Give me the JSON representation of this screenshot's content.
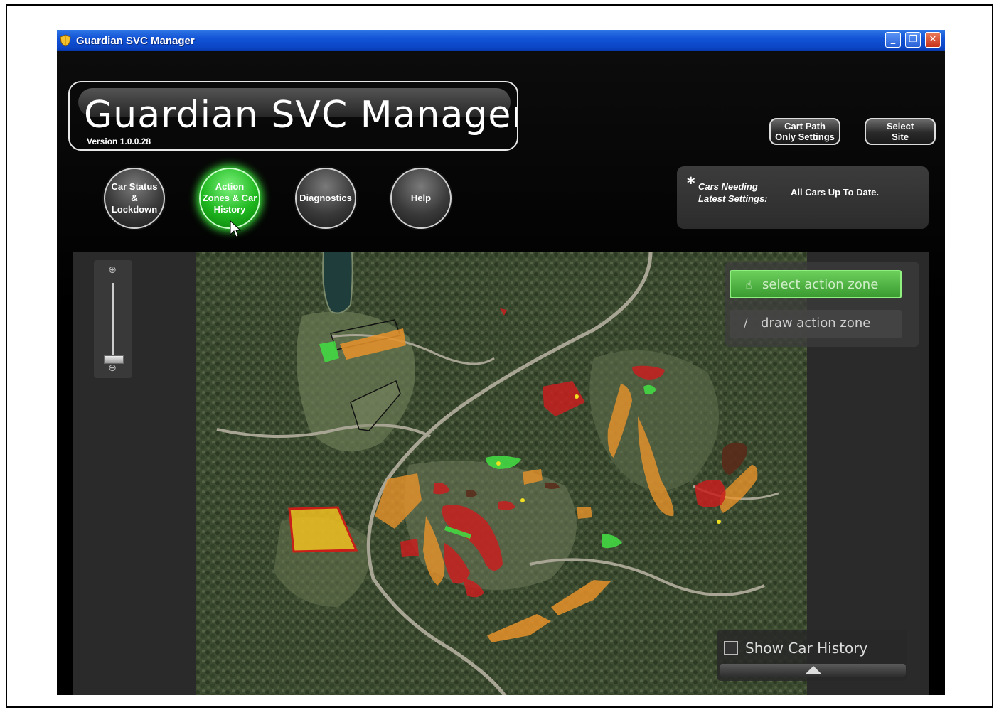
{
  "window": {
    "title": "Guardian SVC Manager",
    "minimize_glyph": "_",
    "maximize_glyph": "❐",
    "close_glyph": "✕"
  },
  "header": {
    "app_title": "Guardian SVC Manager",
    "version": "Version 1.0.0.28"
  },
  "top_buttons": {
    "cart_path_line1": "Cart Path",
    "cart_path_line2": "Only Settings",
    "select_site_line1": "Select",
    "select_site_line2": "Site"
  },
  "nav": {
    "car_status": [
      "Car Status",
      "&",
      "Lockdown"
    ],
    "action_zones": [
      "Action",
      "Zones & Car",
      "History"
    ],
    "diagnostics": "Diagnostics",
    "help": "Help",
    "active": "action_zones"
  },
  "status": {
    "star": "*",
    "label_line1": "Cars Needing",
    "label_line2": "Latest Settings:",
    "value": "All Cars Up To Date."
  },
  "zoom": {
    "in_icon": "zoom-in-icon",
    "out_icon": "zoom-out-icon",
    "in_glyph": "⊕",
    "out_glyph": "⊖"
  },
  "tools": {
    "select_label": "select action zone",
    "select_icon": "☝",
    "draw_label": "draw action zone",
    "draw_icon": "∕",
    "active": "select"
  },
  "history": {
    "label": "Show Car History",
    "checked": false
  },
  "colors": {
    "active_nav": "#22c022",
    "zone_orange": "#e8922a",
    "zone_red": "#c81e1e",
    "zone_green": "#42d842",
    "zone_yellow": "#f0c020",
    "zone_brown": "#5a2a1a"
  }
}
